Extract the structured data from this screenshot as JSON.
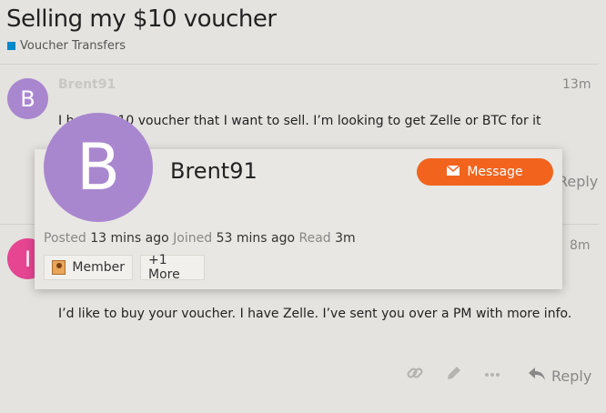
{
  "topic": {
    "title": "Selling my $10 voucher",
    "category": "Voucher Transfers",
    "category_color": "#0088cc"
  },
  "posts": [
    {
      "avatar_letter": "B",
      "avatar_color": "#a987cf",
      "username": "Brent91",
      "time": "13m",
      "body": "I have a $10 voucher that I want to sell. I’m looking to get Zelle or BTC for it",
      "body_visible_prefix": "I h",
      "body_visible_suffix": "10 voucher that I want to sell. I’m looking to get Zelle or BTC for it",
      "reply_label": "Reply"
    },
    {
      "avatar_letter": "I",
      "avatar_color": "#e54591",
      "time": "8m",
      "body": "I’d like to buy your voucher. I have Zelle. I’ve sent you over a PM with more info.",
      "reply_label": "Reply"
    }
  ],
  "user_card": {
    "avatar_letter": "B",
    "username": "Brent91",
    "message_label": "Message",
    "posted_label": "Posted",
    "posted_value": "13 mins ago",
    "joined_label": "Joined",
    "joined_value": "53 mins ago",
    "read_label": "Read",
    "read_value": "3m",
    "badge_label": "Member",
    "more_label": "+1 More",
    "button_color": "#f2631e"
  },
  "icons": {
    "link": "link-icon",
    "edit": "pencil-icon",
    "more": "ellipsis-icon",
    "reply": "reply-arrow-icon",
    "message": "envelope-icon",
    "badge": "member-badge-icon"
  }
}
